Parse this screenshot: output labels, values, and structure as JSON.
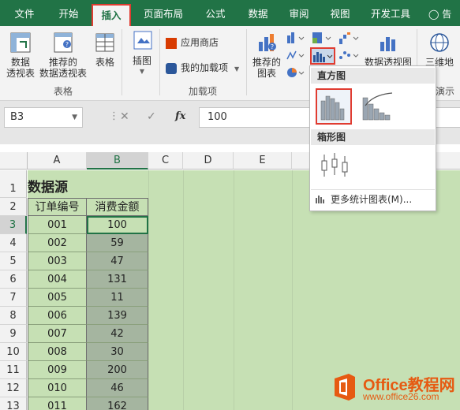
{
  "tabs": [
    {
      "label": "文件",
      "active": false
    },
    {
      "label": "开始",
      "active": false
    },
    {
      "label": "插入",
      "active": true
    },
    {
      "label": "页面布局",
      "active": false
    },
    {
      "label": "公式",
      "active": false
    },
    {
      "label": "数据",
      "active": false
    },
    {
      "label": "审阅",
      "active": false
    },
    {
      "label": "视图",
      "active": false
    },
    {
      "label": "开发工具",
      "active": false
    }
  ],
  "tell_me": "告",
  "ribbon": {
    "pivot_table": "数据\n透视表",
    "recommended_pivot": "推荐的\n数据透视表",
    "table": "表格",
    "illustrations": "插图",
    "group_tables": "表格",
    "store": "应用商店",
    "my_addins": "我的加载项",
    "group_addins": "加载项",
    "recommended_charts": "推荐的\n图表",
    "pivot_chart": "数据透视图",
    "map3d": "三维地",
    "group_tour": "演示"
  },
  "namebox": "B3",
  "formula_value": "100",
  "fx_label": "fx",
  "columns": [
    "A",
    "B",
    "C",
    "D",
    "E"
  ],
  "rows": [
    "1",
    "2",
    "3",
    "4",
    "5",
    "6",
    "7",
    "8",
    "9",
    "10",
    "11",
    "12",
    "13"
  ],
  "sheet": {
    "title": "数据源",
    "header_a": "订单编号",
    "header_b": "消费金额",
    "data": [
      {
        "order": "001",
        "amount": "100"
      },
      {
        "order": "002",
        "amount": "59"
      },
      {
        "order": "003",
        "amount": "47"
      },
      {
        "order": "004",
        "amount": "131"
      },
      {
        "order": "005",
        "amount": "11"
      },
      {
        "order": "006",
        "amount": "139"
      },
      {
        "order": "007",
        "amount": "42"
      },
      {
        "order": "008",
        "amount": "30"
      },
      {
        "order": "009",
        "amount": "200"
      },
      {
        "order": "010",
        "amount": "46"
      },
      {
        "order": "011",
        "amount": "162"
      }
    ]
  },
  "dropdown": {
    "histogram_section": "直方图",
    "boxplot_section": "箱形图",
    "more_charts": "更多统计图表(M)..."
  },
  "watermark": {
    "title": "Office教程网",
    "url": "www.office26.com"
  },
  "colors": {
    "excel_green": "#217346",
    "highlight_red": "#e03c31",
    "sheet_green": "#c6e0b4",
    "selected_cell": "#a5b5a0"
  }
}
